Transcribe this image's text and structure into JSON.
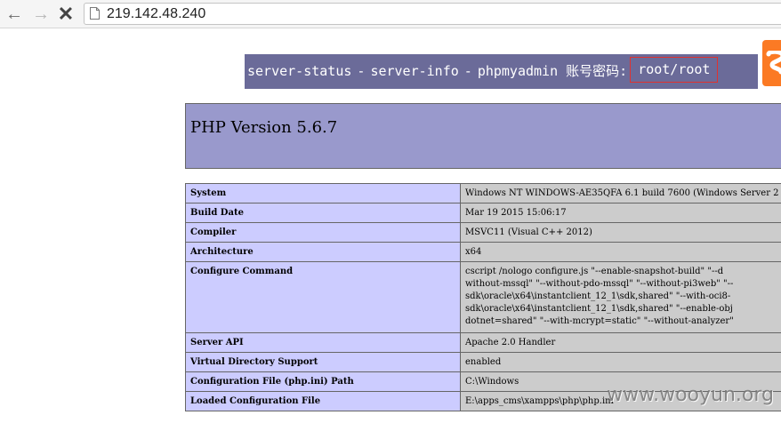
{
  "browser": {
    "url": "219.142.48.240"
  },
  "banner": {
    "server_status": "server-status",
    "separator": "-",
    "server_info": "server-info",
    "phpmyadmin": "phpmyadmin",
    "creds_label": "账号密码:",
    "creds_value": "root/root"
  },
  "phpinfo": {
    "title": "PHP Version 5.6.7",
    "rows": [
      {
        "key": "System",
        "value": "Windows NT WINDOWS-AE35QFA 6.1 build 7600 (Windows Server 2"
      },
      {
        "key": "Build Date",
        "value": "Mar 19 2015 15:06:17"
      },
      {
        "key": "Compiler",
        "value": "MSVC11 (Visual C++ 2012)"
      },
      {
        "key": "Architecture",
        "value": "x64"
      },
      {
        "key": "Configure Command",
        "value": "cscript /nologo configure.js \"--enable-snapshot-build\" \"--d\nwithout-mssql\" \"--without-pdo-mssql\" \"--without-pi3web\" \"--\nsdk\\oracle\\x64\\instantclient_12_1\\sdk,shared\" \"--with-oci8-\nsdk\\oracle\\x64\\instantclient_12_1\\sdk,shared\" \"--enable-obj\ndotnet=shared\" \"--with-mcrypt=static\" \"--without-analyzer\""
      },
      {
        "key": "Server API",
        "value": "Apache 2.0 Handler"
      },
      {
        "key": "Virtual Directory Support",
        "value": "enabled"
      },
      {
        "key": "Configuration File (php.ini) Path",
        "value": "C:\\Windows"
      },
      {
        "key": "Loaded Configuration File",
        "value": "E:\\apps_cms\\xampps\\php\\php.ini"
      }
    ]
  },
  "watermark": "www.wooyun.org",
  "colors": {
    "banner_bg": "#6b6b99",
    "header_bg": "#9999cc",
    "key_cell_bg": "#ccccff",
    "value_cell_bg": "#cccccc",
    "highlight_border": "#e0322f",
    "logo_orange": "#fb7a24"
  }
}
